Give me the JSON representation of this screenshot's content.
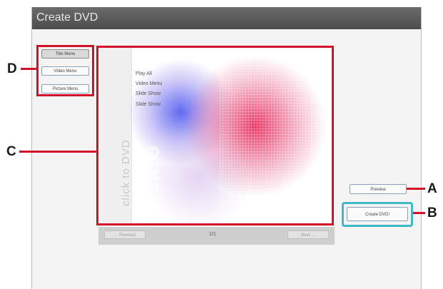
{
  "window": {
    "title": "Create DVD"
  },
  "menu_tabs": [
    {
      "label": "Title Menu"
    },
    {
      "label": "Video Menu"
    },
    {
      "label": "Picture Menu"
    }
  ],
  "menu_preview": {
    "items": [
      "Play All",
      "Video Menu",
      "Slide Show",
      "Slide Show"
    ],
    "brand_text": "click to DVD"
  },
  "navigation": {
    "prev_label": "← Previous",
    "page_indicator": "1/1",
    "next_label": "Next →"
  },
  "buttons": {
    "preview_label": "Preview",
    "create_label": "Create DVD!"
  },
  "callouts": {
    "a": "A",
    "b": "B",
    "c": "C",
    "d": "D"
  },
  "colors": {
    "callout_red": "#d5112a",
    "create_highlight": "#3fb8c8"
  }
}
